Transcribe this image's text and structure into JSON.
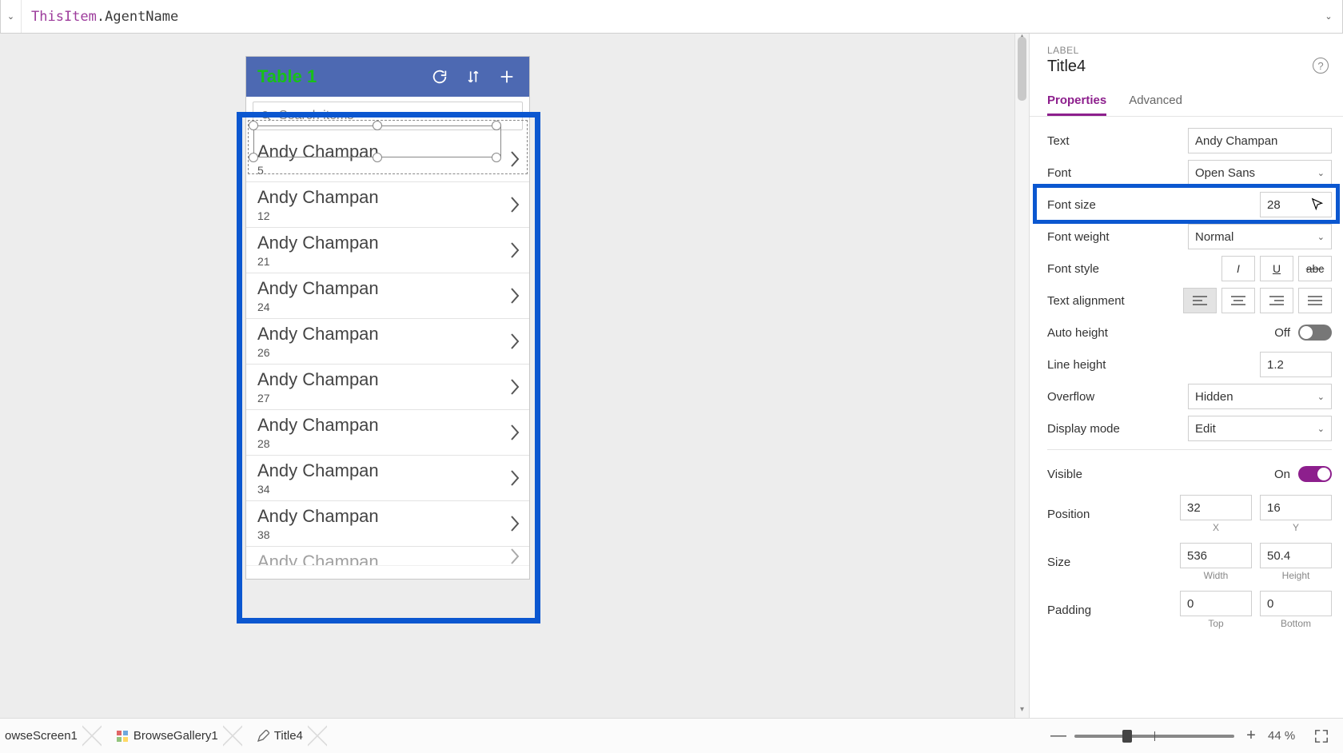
{
  "formula": {
    "object": "ThisItem",
    "prop": ".AgentName"
  },
  "app": {
    "title": "Table 1",
    "searchPlaceholder": "Search items",
    "items": [
      {
        "name": "Andy Champan",
        "sub": "5"
      },
      {
        "name": "Andy Champan",
        "sub": "12"
      },
      {
        "name": "Andy Champan",
        "sub": "21"
      },
      {
        "name": "Andy Champan",
        "sub": "24"
      },
      {
        "name": "Andy Champan",
        "sub": "26"
      },
      {
        "name": "Andy Champan",
        "sub": "27"
      },
      {
        "name": "Andy Champan",
        "sub": "28"
      },
      {
        "name": "Andy Champan",
        "sub": "34"
      },
      {
        "name": "Andy Champan",
        "sub": "38"
      },
      {
        "name": "Andy Champan",
        "sub": ""
      }
    ]
  },
  "panel": {
    "kind": "LABEL",
    "name": "Title4",
    "tabs": [
      "Properties",
      "Advanced"
    ],
    "labels": {
      "text": "Text",
      "font": "Font",
      "fontSize": "Font size",
      "fontWeight": "Font weight",
      "fontStyle": "Font style",
      "align": "Text alignment",
      "autoHeight": "Auto height",
      "lineHeight": "Line height",
      "overflow": "Overflow",
      "displayMode": "Display mode",
      "visible": "Visible",
      "position": "Position",
      "size": "Size",
      "padding": "Padding"
    },
    "values": {
      "text": "Andy Champan",
      "font": "Open Sans",
      "fontSize": "28",
      "fontWeight": "Normal",
      "autoHeight": "Off",
      "lineHeight": "1.2",
      "overflow": "Hidden",
      "displayMode": "Edit",
      "visible": "On",
      "posX": "32",
      "posY": "16",
      "width": "536",
      "height": "50.4",
      "padTop": "0",
      "padBottom": "0"
    },
    "captions": {
      "x": "X",
      "y": "Y",
      "w": "Width",
      "h": "Height",
      "top": "Top",
      "bottom": "Bottom"
    }
  },
  "breadcrumbs": [
    "owseScreen1",
    "BrowseGallery1",
    "Title4"
  ],
  "zoom": {
    "pct": "44  %"
  }
}
